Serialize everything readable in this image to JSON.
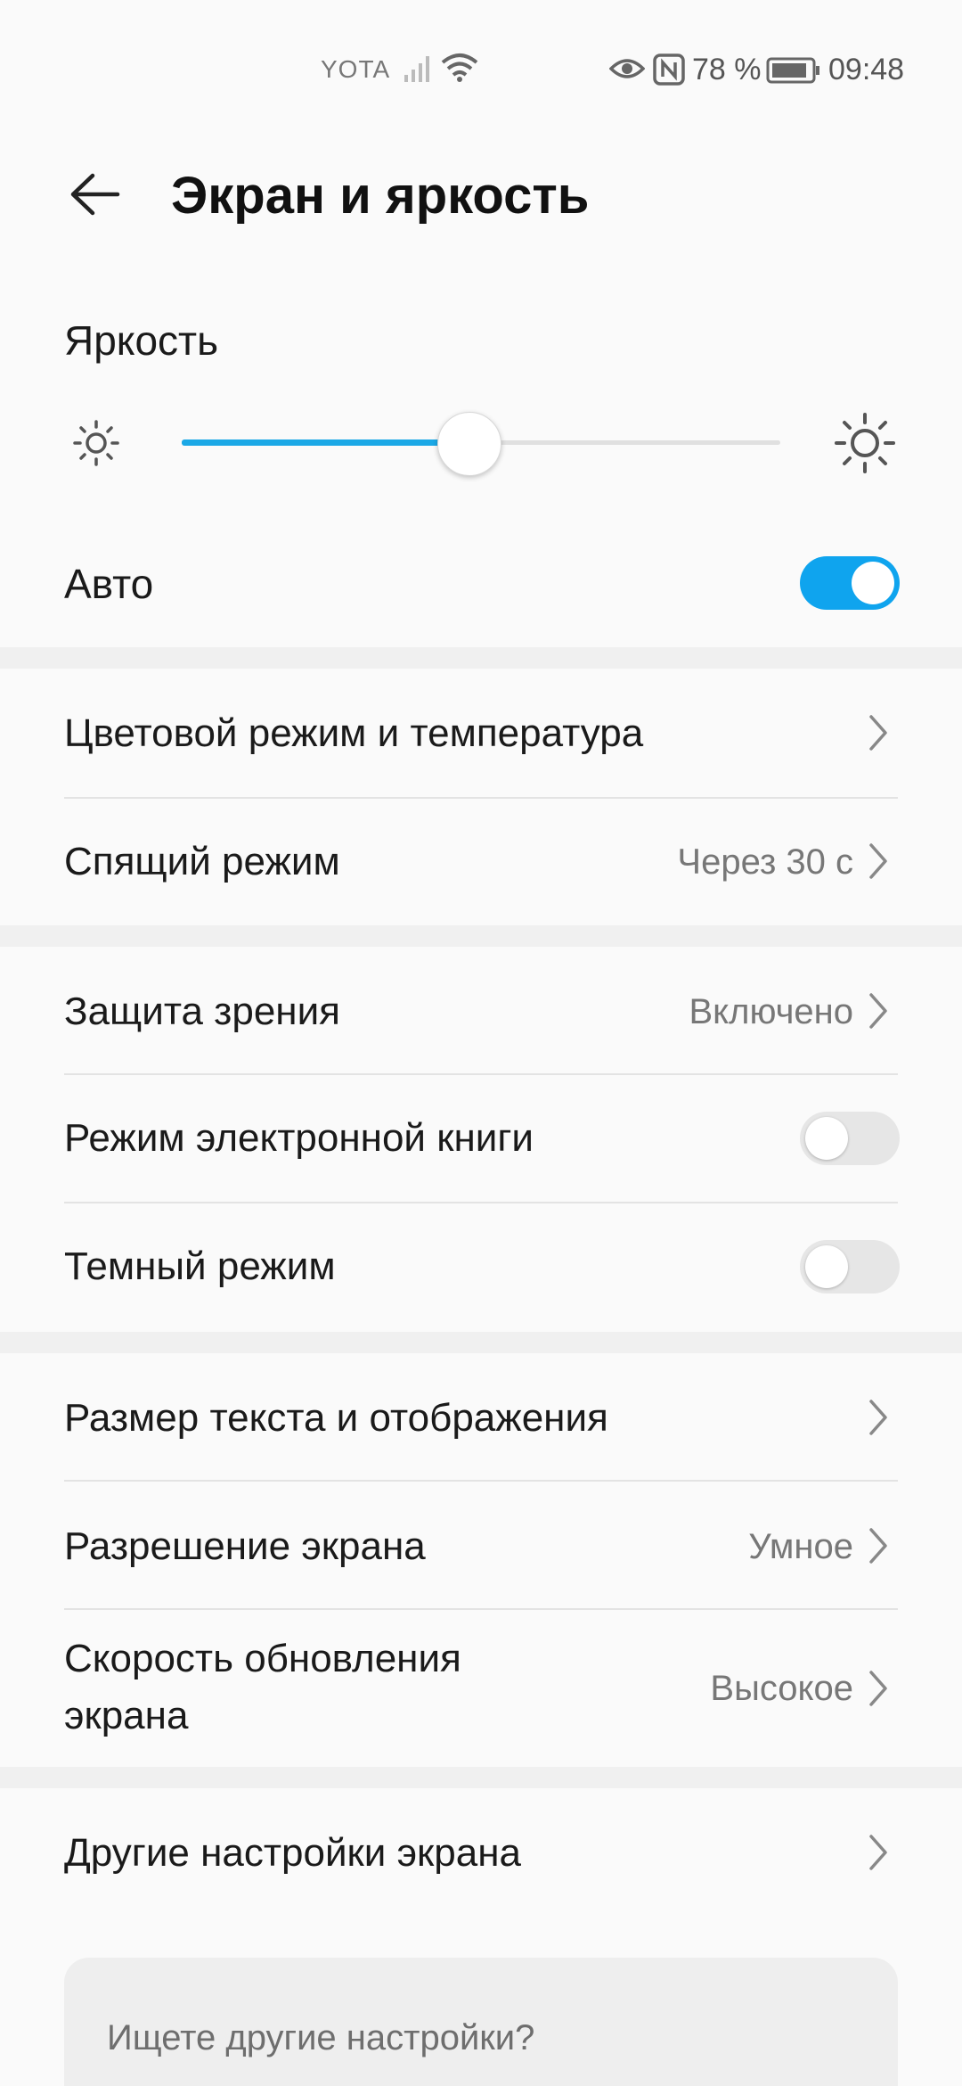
{
  "status_bar": {
    "operator": "YOTA",
    "battery_percent": "78 %",
    "time": "09:48",
    "icons": [
      "signal-icon",
      "wifi-icon",
      "eye-comfort-icon",
      "nfc-icon",
      "battery-icon"
    ]
  },
  "header": {
    "title": "Экран и яркость",
    "back_icon": "back-arrow-icon"
  },
  "brightness": {
    "label": "Яркость",
    "level": 0.48,
    "auto_label": "Авто",
    "auto_enabled": true
  },
  "groups": [
    {
      "rows": [
        {
          "label": "Цветовой режим и температура",
          "value": ""
        },
        {
          "label": "Спящий режим",
          "value": "Через 30 с"
        }
      ]
    },
    {
      "rows": [
        {
          "label": "Защита зрения",
          "value": "Включено"
        },
        {
          "label": "Режим электронной книги",
          "toggle": false
        },
        {
          "label": "Темный режим",
          "toggle": false
        }
      ]
    },
    {
      "rows": [
        {
          "label": "Размер текста и отображения",
          "value": ""
        },
        {
          "label": "Разрешение экрана",
          "value": "Умное"
        },
        {
          "label_line1": "Скорость обновления",
          "label_line2": "экрана",
          "value": "Высокое"
        }
      ]
    },
    {
      "rows": [
        {
          "label": "Другие настройки экрана",
          "value": ""
        }
      ]
    }
  ],
  "search_prompt": "Ищете другие настройки?",
  "colors": {
    "accent": "#0fa4ee",
    "slider_fill": "#1ba8e6",
    "background": "#fafafa",
    "separator": "#f0f0f0"
  }
}
